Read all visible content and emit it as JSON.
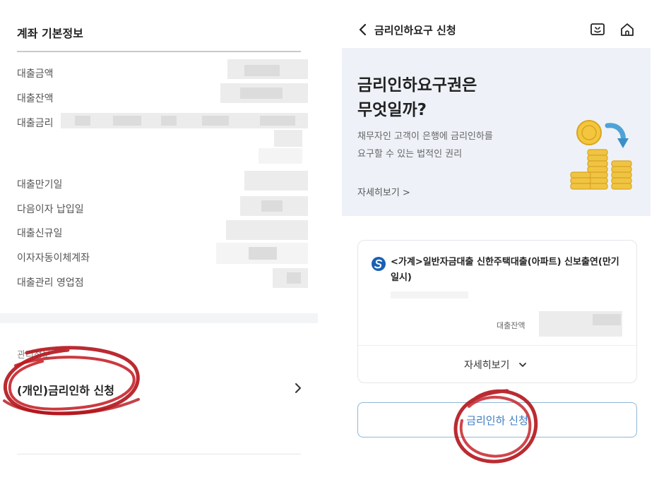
{
  "left": {
    "title": "계좌 기본정보",
    "info_labels": [
      "대출금액",
      "대출잔액",
      "대출금리",
      "대출만기일",
      "다음이자 납입일",
      "대출신규일",
      "이자자동이체계좌",
      "대출관리 영업점"
    ],
    "section_label": "관리정보",
    "apply_label": "(개인)금리인하 신청"
  },
  "right": {
    "header": {
      "title": "금리인하요구 신청"
    },
    "banner": {
      "headline_line1": "금리인하요구권은",
      "headline_line2": "무엇일까?",
      "sub_line1": "채무자인 고객이 은행에 금리인하를",
      "sub_line2": "요구할 수 있는 법적인 권리",
      "more_link": "자세히보기 >"
    },
    "card": {
      "title": "<가계>일반자금대출 신한주택대출(아파트) 신보출연(만기일시)",
      "balance_label": "대출잔액",
      "more_label": "자세히보기"
    },
    "apply_button": "금리인하 신청"
  },
  "colors": {
    "accent_blue": "#3b7bc0",
    "button_border": "#8fb7d6",
    "banner_bg": "#eef1f7",
    "annotation_red": "#b3141b"
  },
  "icons": [
    "back-arrow-icon",
    "chatbot-icon",
    "home-icon",
    "chevron-right-icon",
    "chevron-down-icon",
    "bank-logo-icon",
    "coins-illustration"
  ]
}
